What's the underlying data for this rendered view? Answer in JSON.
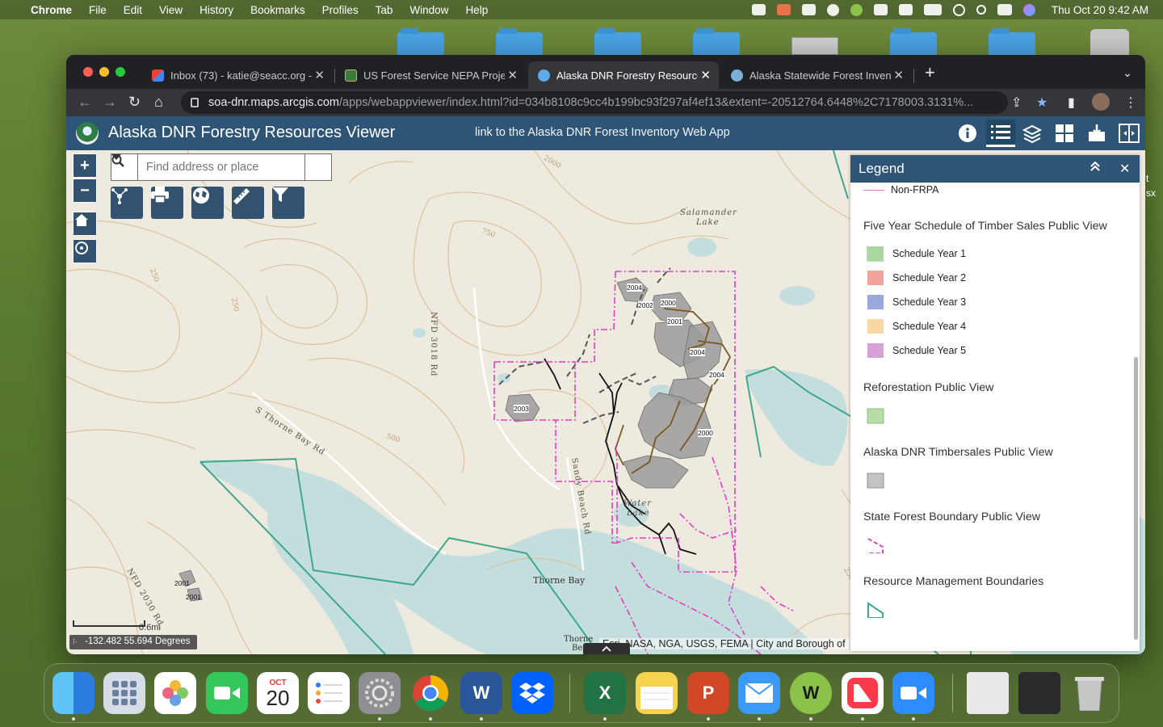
{
  "menubar": {
    "app": "Chrome",
    "items": [
      "File",
      "Edit",
      "View",
      "History",
      "Bookmarks",
      "Profiles",
      "Tab",
      "Window",
      "Help"
    ],
    "clock": "Thu Oct 20  9:42 AM"
  },
  "tabs": [
    {
      "label": "Inbox (73) - katie@seacc.org -",
      "icon": "gmail-icon",
      "active": false
    },
    {
      "label": "US Forest Service NEPA Projec",
      "icon": "forest-service-icon",
      "active": false
    },
    {
      "label": "Alaska DNR Forestry Resource",
      "icon": "arcgis-icon",
      "active": true
    },
    {
      "label": "Alaska Statewide Forest Invent",
      "icon": "globe-icon",
      "active": false
    }
  ],
  "address": {
    "host": "soa-dnr.maps.arcgis.com",
    "path": "/apps/webappviewer/index.html?id=034b8108c9cc4b199bc93f297af4ef13&extent=-20512764.6448%2C7178003.3131%..."
  },
  "app": {
    "title": "Alaska DNR Forestry Resources Viewer",
    "link": "link to the Alaska DNR Forest Inventory Web App"
  },
  "map": {
    "search_placeholder": "Find address or place",
    "scale_label": "0.6mi",
    "coordinates": "-132.482 55.694 Degrees",
    "attribution": "Esri, NASA, NGA, USGS, FEMA | City and Borough of",
    "place_labels": {
      "salamander": "Salamander",
      "salamander2": "Lake",
      "water": "Water",
      "water2": "Lake",
      "thorne_bay": "Thorne Bay",
      "thorne2": "Thorne",
      "thorne3": "Be",
      "nfd3018": "NFD 3018 Rd",
      "s_thorne": "S Thorne Bay Rd",
      "sandy": "Sandy Beach Rd",
      "nfd2030": "NFD 2030 Rd"
    },
    "contour_labels": [
      "2000",
      "750",
      "250",
      "500",
      "250",
      "250"
    ],
    "harvest_years": [
      "2004",
      "2002",
      "2000",
      "2001",
      "2004",
      "2004",
      "2000",
      "2003",
      "2001",
      "2001"
    ]
  },
  "legend": {
    "title": "Legend",
    "top_item": "Non-FRPA",
    "sections": [
      {
        "title": "Five Year Schedule of Timber Sales Public View",
        "items": [
          {
            "label": "Schedule Year 1",
            "color": "#a8d8a0"
          },
          {
            "label": "Schedule Year 2",
            "color": "#f2a39c"
          },
          {
            "label": "Schedule Year 3",
            "color": "#9aa9dc"
          },
          {
            "label": "Schedule Year 4",
            "color": "#f8d8a2"
          },
          {
            "label": "Schedule Year 5",
            "color": "#d9a2d6"
          }
        ]
      },
      {
        "title": "Reforestation Public View",
        "items": [
          {
            "label": "",
            "color": "#b7dca5"
          }
        ]
      },
      {
        "title": "Alaska DNR Timbersales Public View",
        "items": [
          {
            "label": "",
            "color": "#c4c4c4"
          }
        ]
      },
      {
        "title": "State Forest Boundary Public View",
        "items": [
          {
            "label": "",
            "color": "#e040c0"
          }
        ]
      },
      {
        "title": "Resource Management Boundaries",
        "items": [
          {
            "label": "",
            "color": "#3ea88a"
          }
        ]
      }
    ]
  },
  "colors": {
    "app_header": "#2f5576",
    "map_land": "#efeadf",
    "water": "#c4dedd",
    "contour": "#d8bf95",
    "state_forest_boundary": "#e040c0",
    "resource_boundary": "#3ea88a"
  },
  "dock": [
    "Finder",
    "Launchpad",
    "Photos",
    "FaceTime",
    "Calendar",
    "Reminders",
    "System Preferences",
    "Chrome",
    "Word",
    "Dropbox",
    "Excel",
    "Notes",
    "PowerPoint",
    "Mail",
    "Whimsical",
    "News",
    "Zoom",
    "Document",
    "Terminal",
    "Trash"
  ],
  "calendar": {
    "month": "OCT",
    "day": "20"
  }
}
